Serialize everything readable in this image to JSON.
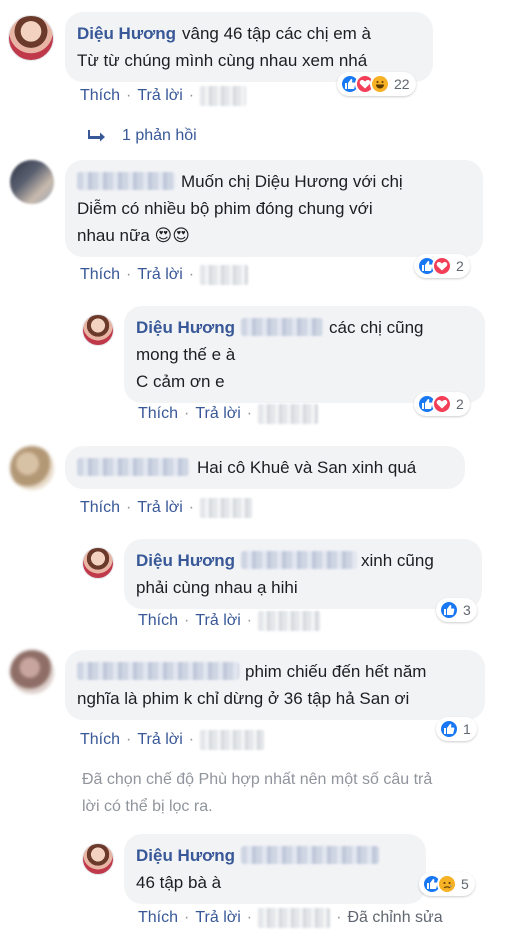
{
  "labels": {
    "like": "Thích",
    "reply": "Trả lời",
    "sep": "·"
  },
  "comments": [
    {
      "author": "Diệu Hương",
      "lines": [
        "vâng 46 tập các chị em à",
        "Từ từ chúng mình cùng nhau xem nhá"
      ],
      "reactions": [
        "like",
        "love",
        "haha"
      ],
      "count": "22"
    },
    {
      "lines": [
        "Muốn chị Diệu Hương với chị",
        "Diễm có nhiều bộ phim đóng chung với",
        "nhau nữa 😍😍"
      ],
      "reactions": [
        "like",
        "love"
      ],
      "count": "2"
    },
    {
      "author": "Diệu Hương",
      "lines": [
        "các chị cũng",
        "mong thế e à",
        "C cảm ơn e"
      ],
      "reactions": [
        "like",
        "love"
      ],
      "count": "2"
    },
    {
      "lines": [
        "Hai cô Khuê và San xinh quá"
      ]
    },
    {
      "author": "Diệu Hương",
      "lines": [
        "xinh cũng",
        "phải cùng nhau ạ hihi"
      ],
      "reactions": [
        "like"
      ],
      "count": "3"
    },
    {
      "lines": [
        "phim chiếu đến hết năm",
        "nghĩa là phim k chỉ dừng ở 36 tập hả San ơi"
      ],
      "reactions": [
        "like"
      ],
      "count": "1"
    },
    {
      "author": "Diệu Hương",
      "lines": [
        "46 tập bà à"
      ],
      "reactions": [
        "like",
        "sad"
      ],
      "count": "5",
      "edited": "Đã chỉnh sửa"
    }
  ],
  "replies_link": "1 phản hồi",
  "filter_note": [
    "Đã chọn chế độ Phù hợp nhất nên một số câu trả",
    "lời có thể bị lọc ra."
  ],
  "colors": {
    "link": "#385898",
    "bubble": "#f2f3f5",
    "muted": "#90949c",
    "like": "#1877f2",
    "love": "#f33e58"
  },
  "icons": [
    "reply-arrow-icon",
    "like-reaction-icon",
    "love-reaction-icon",
    "haha-reaction-icon",
    "sad-reaction-icon"
  ]
}
